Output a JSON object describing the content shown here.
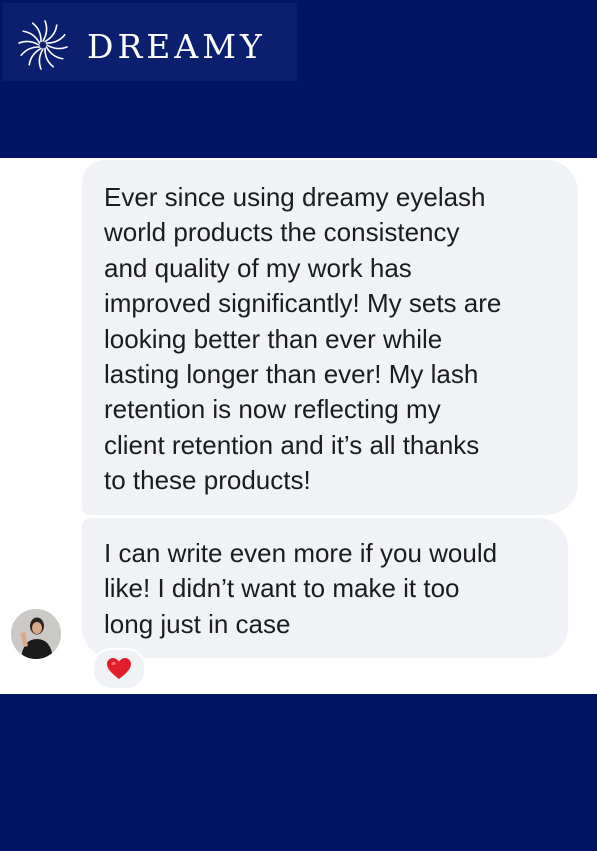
{
  "brand": {
    "name": "DREAMY",
    "logo_icon": "swirl-icon",
    "primary_color": "#011567",
    "logo_box_color": "#0b1f6e"
  },
  "conversation": {
    "messages": [
      {
        "text": "Ever since using dreamy eyelash world products the consistency and quality of my work has improved significantly! My sets are looking better than ever while lasting longer than ever! My lash retention is now reflecting my client retention and it’s all thanks to these products!",
        "lines": [
          "Ever since using dreamy eyelash",
          "world products the consistency",
          "and quality of my work has",
          "improved significantly! My sets are",
          "looking better than ever while",
          "lasting longer than ever! My lash",
          "retention is now reflecting my",
          "client retention and it’s all thanks",
          "to these products!"
        ]
      },
      {
        "text": "I can write even more if you would like! I didn’t want to make it too long just in case",
        "lines": [
          "I can write even more if you would",
          "like! I didn’t want to make it too",
          "long just in case"
        ],
        "reaction": "heart-icon"
      }
    ],
    "sender_avatar": "avatar",
    "bubble_color": "#f1f2f5",
    "reaction_color": "#e01e2b"
  }
}
